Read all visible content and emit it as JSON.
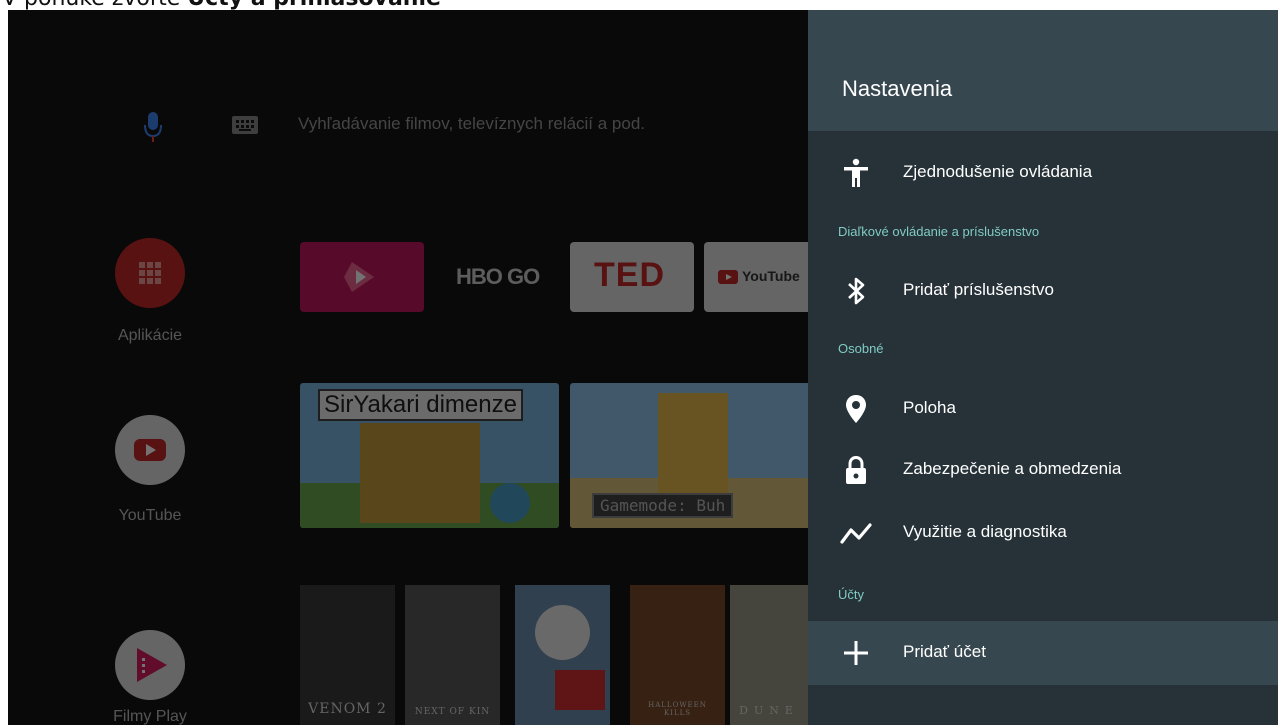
{
  "caption": {
    "prefix": "V ponuke zvoľte",
    "bold": "Účty a prihlasovanie"
  },
  "home": {
    "search_placeholder": "Vyhľadávanie filmov, televíznych relácií a pod.",
    "apps": [
      {
        "label": "Aplikácie"
      },
      {
        "label": "YouTube"
      },
      {
        "label": "Filmy Play"
      }
    ],
    "channels": [
      {
        "name": "HBO GO"
      },
      {
        "name": "TED"
      },
      {
        "name": "YouTube"
      }
    ],
    "thumbnails": [
      {
        "title": "SirYakari dimenze"
      },
      {
        "title": "Gamemode: Buh"
      }
    ],
    "posters": [
      {
        "title": "VENOM 2"
      },
      {
        "title": "NEXT OF KIN"
      },
      {
        "title": ""
      },
      {
        "title": "HALLOWEEN KILLS"
      },
      {
        "title": "DUNE"
      }
    ]
  },
  "settings": {
    "title": "Nastavenia",
    "items": [
      {
        "type": "row",
        "label": "Zjednodušenie ovládania",
        "icon": "accessibility-icon"
      },
      {
        "type": "section",
        "label": "Diaľkové ovládanie a príslušenstvo"
      },
      {
        "type": "row",
        "label": "Pridať príslušenstvo",
        "icon": "bluetooth-icon"
      },
      {
        "type": "section",
        "label": "Osobné"
      },
      {
        "type": "row",
        "label": "Poloha",
        "icon": "location-icon"
      },
      {
        "type": "row",
        "label": "Zabezpečenie a obmedzenia",
        "icon": "lock-icon"
      },
      {
        "type": "row",
        "label": "Využitie a diagnostika",
        "icon": "trending-icon"
      },
      {
        "type": "section",
        "label": "Účty"
      },
      {
        "type": "row",
        "label": "Pridať účet",
        "icon": "plus-icon",
        "selected": true
      }
    ]
  },
  "colors": {
    "panel_bg": "#263238",
    "panel_header": "#37474f",
    "section_text": "#80cbc4",
    "selected_row": "#37474f"
  }
}
